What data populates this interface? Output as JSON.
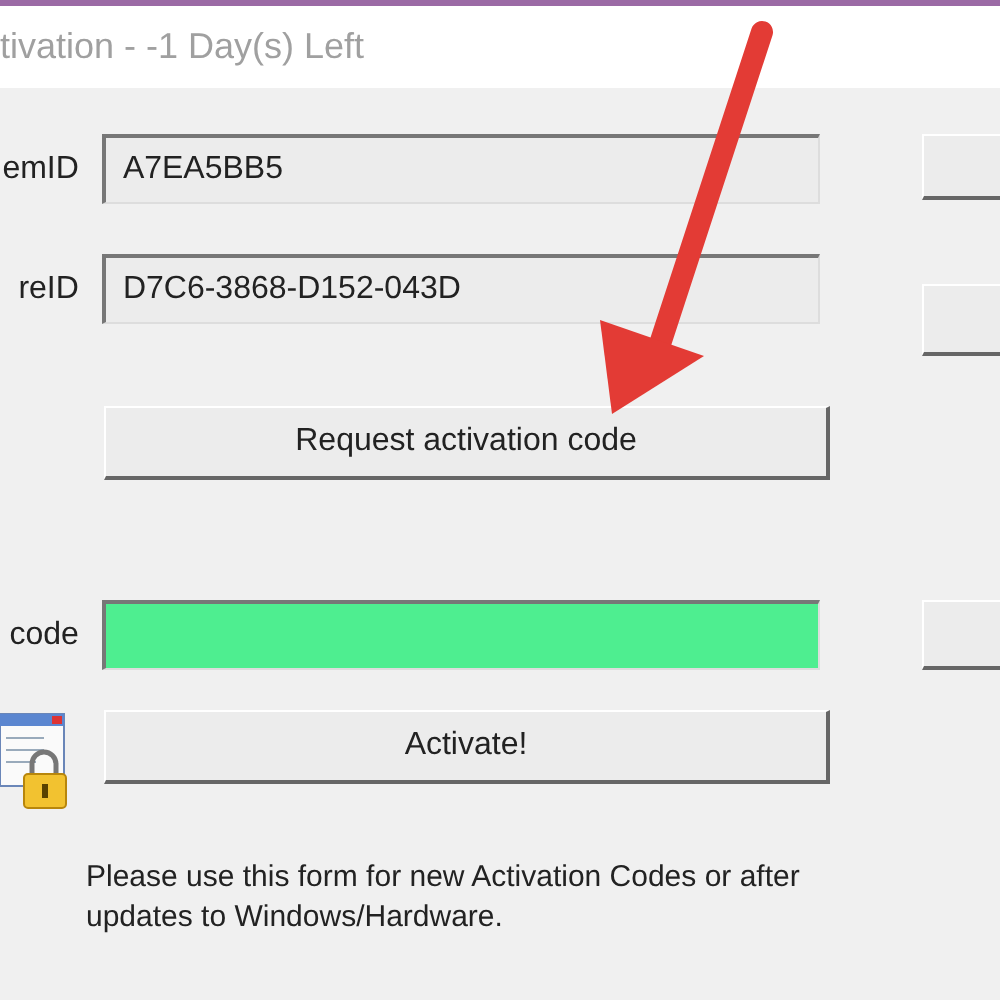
{
  "window": {
    "title": "tivation - -1 Day(s) Left"
  },
  "fields": [
    {
      "label": "emID",
      "value": "A7EA5BB5",
      "highlighted": false
    },
    {
      "label": "reID",
      "value": "D7C6-3868-D152-043D",
      "highlighted": false
    }
  ],
  "request_button": "Request activation code",
  "code_field": {
    "label": "code",
    "highlighted": true
  },
  "activate_button": "Activate!",
  "note": "Please use this form for new Activation Codes or after updates to Windows/Hardware."
}
